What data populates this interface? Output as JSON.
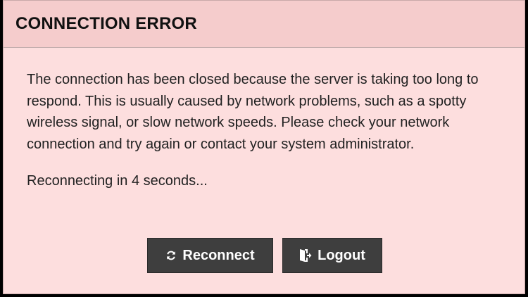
{
  "dialog": {
    "title": "CONNECTION ERROR",
    "message": "The connection has been closed because the server is taking too long to respond. This is usually caused by network problems, such as a spotty wireless signal, or slow network speeds. Please check your network connection and try again or contact your system administrator.",
    "countdown": "Reconnecting in 4 seconds...",
    "buttons": {
      "reconnect_label": "Reconnect",
      "reconnect_icon": "refresh-icon",
      "logout_label": "Logout",
      "logout_icon": "sign-out-icon"
    }
  },
  "colors": {
    "dialog_background": "#fddede",
    "header_background": "#f5cccc",
    "button_background": "#3e3e3e",
    "button_text": "#ffffff"
  }
}
